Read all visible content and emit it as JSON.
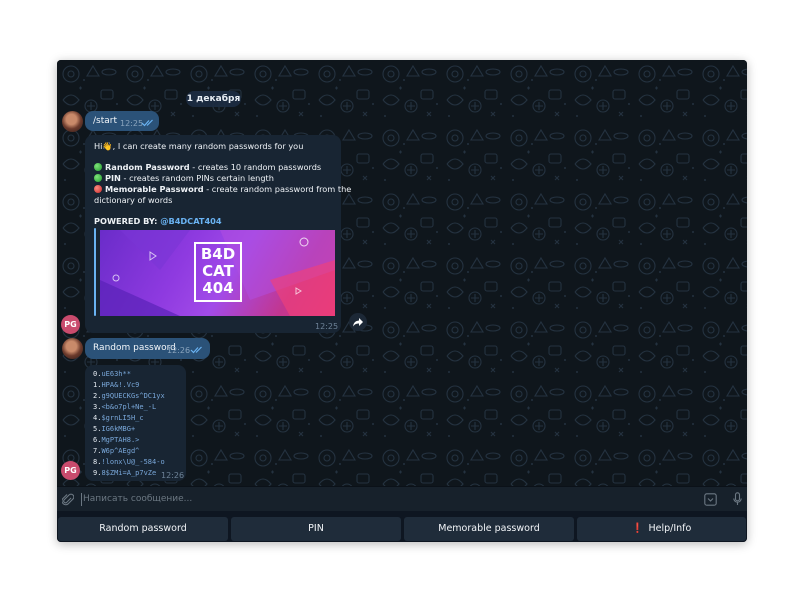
{
  "chat": {
    "date_label": "1 декабря",
    "messages": {
      "start": {
        "text": "/start",
        "time": "12:25"
      },
      "info": {
        "greeting": "Hi👋, I can create many random passwords for you",
        "features": [
          {
            "name": "Random Password",
            "desc": " - creates 10 random passwords",
            "color": "#2fbf3a"
          },
          {
            "name": "PIN",
            "desc": " - creates random PINs certain length",
            "color": "#2fbf3a"
          },
          {
            "name": "Memorable Password",
            "desc": " - create random password from the",
            "desc_line2": "dictionary of words",
            "color": "#e53935"
          }
        ],
        "powered_label": "POWERED BY: ",
        "powered_link": "@B4DCAT404",
        "logo_lines": [
          "B4D",
          "CAT",
          "404"
        ],
        "time": "12:25"
      },
      "random": {
        "text": "Random password",
        "time": "12:26"
      },
      "passwords": {
        "items": [
          {
            "idx": "0.",
            "val": "uE63h**"
          },
          {
            "idx": "1.",
            "val": "HPA&!.Vc9"
          },
          {
            "idx": "2.",
            "val": "g9QUECKGs^DC1yx"
          },
          {
            "idx": "3.",
            "val": "<b&o7pl+Ne_-L"
          },
          {
            "idx": "4.",
            "val": "$grnLI5H_c"
          },
          {
            "idx": "5.",
            "val": "IG6kMBG+"
          },
          {
            "idx": "6.",
            "val": "MgPTAH8.>"
          },
          {
            "idx": "7.",
            "val": "W6p^AEgd^"
          },
          {
            "idx": "8.",
            "val": "!lonx\\U@_-584-o"
          },
          {
            "idx": "9.",
            "val": "8$ZMi=A_p7vZe"
          }
        ],
        "time": "12:26"
      }
    },
    "avatar_initials": "PG"
  },
  "input": {
    "placeholder": "Написать сообщение..."
  },
  "keyboard": {
    "buttons": [
      {
        "label": "Random password"
      },
      {
        "label": "PIN"
      },
      {
        "label": "Memorable password"
      },
      {
        "label": "Help/Info",
        "prefix_icon": "exclamation-icon"
      }
    ]
  },
  "colors": {
    "outgoing_bubble": "#2b5278",
    "incoming_bubble": "#182533",
    "accent_link": "#6ab3f3",
    "avatar_pg": "#c94b6d",
    "keyboard_button": "#1f2c3a"
  }
}
